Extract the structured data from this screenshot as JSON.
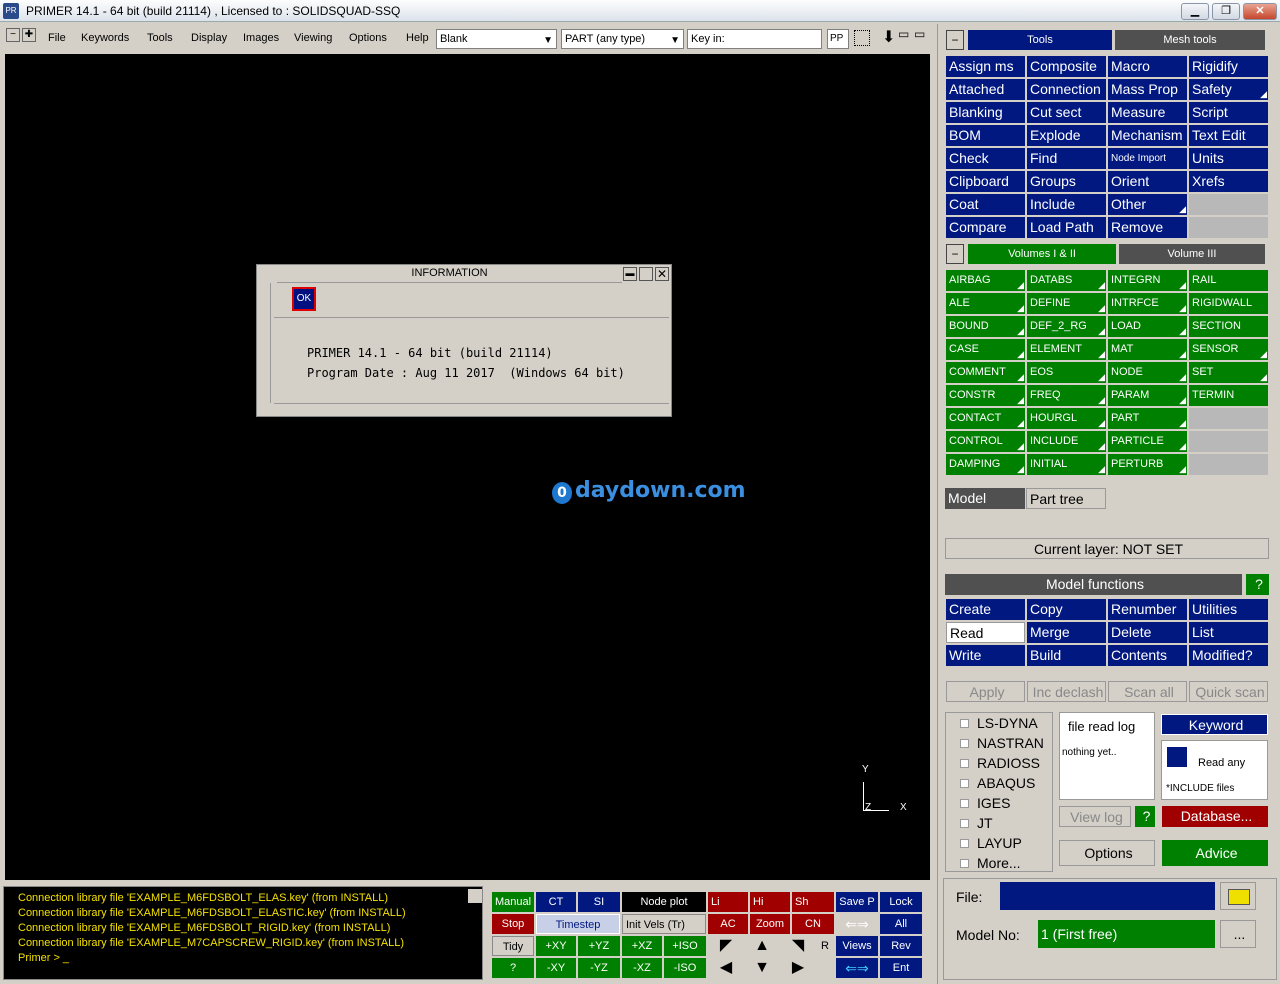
{
  "window": {
    "title": "PRIMER 14.1 - 64 bit (build 21114) , Licensed to : SOLIDSQUAD-SSQ",
    "app_icon": "PR"
  },
  "menu": [
    "File",
    "Keywords",
    "Tools",
    "Display",
    "Images",
    "Viewing",
    "Options",
    "Help"
  ],
  "toolbar": {
    "blank_select": "Blank",
    "part_select": "PART  (any type)",
    "keyin_label": "Key in:",
    "pp_label": "PP"
  },
  "dialog": {
    "title": "INFORMATION",
    "ok": "OK",
    "line1": "PRIMER 14.1 - 64 bit (build 21114)",
    "line2": "Program Date : Aug 11 2017  (Windows 64 bit)"
  },
  "watermark": "daydown.com",
  "axes": {
    "y": "Y",
    "x": "X",
    "z": "Z"
  },
  "console": [
    "Connection library file 'EXAMPLE_M6FDSBOLT_ELAS.key' (from INSTALL)",
    "Connection library file 'EXAMPLE_M6FDSBOLT_ELASTIC.key' (from INSTALL)",
    "Connection library file 'EXAMPLE_M6FDSBOLT_RIGID.key' (from INSTALL)",
    "Connection library file 'EXAMPLE_M7CAPSCREW_RIGID.key' (from INSTALL)",
    "Primer > _"
  ],
  "bottom": {
    "manual": "Manual",
    "ct": "CT",
    "si": "SI",
    "node_plot": "Node plot",
    "li": "Li",
    "hi": "Hi",
    "sh": "Sh",
    "save_p": "Save P",
    "lock": "Lock",
    "stop": "Stop",
    "timestep": "Timestep",
    "init_vels": "Init Vels (Tr)",
    "ac": "AC",
    "zoom": "Zoom",
    "cn": "CN",
    "all": "All",
    "tidy": "Tidy",
    "pxy": "+XY",
    "pyz": "+YZ",
    "pxz": "+XZ",
    "piso": "+ISO",
    "r": "R",
    "views": "Views",
    "rev": "Rev",
    "q": "?",
    "mxy": "-XY",
    "myz": "-YZ",
    "mxz": "-XZ",
    "miso": "-ISO",
    "ent": "Ent"
  },
  "tools": {
    "tab_tools": "Tools",
    "tab_mesh": "Mesh tools",
    "grid": [
      [
        "Assign ms",
        "Composite",
        "Macro",
        "Rigidify"
      ],
      [
        "Attached",
        "Connection",
        "Mass Prop",
        "Safety"
      ],
      [
        "Blanking",
        "Cut sect",
        "Measure",
        "Script"
      ],
      [
        "BOM",
        "Explode",
        "Mechanism",
        "Text Edit"
      ],
      [
        "Check",
        "Find",
        "Node Import",
        "Units"
      ],
      [
        "Clipboard",
        "Groups",
        "Orient",
        "Xrefs"
      ],
      [
        "Coat",
        "Include",
        "Other",
        ""
      ],
      [
        "Compare",
        "Load Path",
        "Remove",
        ""
      ]
    ]
  },
  "keywords": {
    "tab_vol12": "Volumes I & II",
    "tab_vol3": "Volume III",
    "grid": [
      [
        "AIRBAG",
        "DATABS",
        "INTEGRN",
        "RAIL"
      ],
      [
        "ALE",
        "DEFINE",
        "INTRFCE",
        "RIGIDWALL"
      ],
      [
        "BOUND",
        "DEF_2_RG",
        "LOAD",
        "SECTION"
      ],
      [
        "CASE",
        "ELEMENT",
        "MAT",
        "SENSOR"
      ],
      [
        "COMMENT",
        "EOS",
        "NODE",
        "SET"
      ],
      [
        "CONSTR",
        "FREQ",
        "PARAM",
        "TERMIN"
      ],
      [
        "CONTACT",
        "HOURGL",
        "PART",
        ""
      ],
      [
        "CONTROL",
        "INCLUDE",
        "PARTICLE",
        ""
      ],
      [
        "DAMPING",
        "INITIAL",
        "PERTURB",
        ""
      ]
    ]
  },
  "tree": {
    "model": "Model",
    "part_tree": "Part tree",
    "layer": "Current layer: NOT SET"
  },
  "model_functions": {
    "title": "Model functions",
    "help": "?",
    "grid": [
      [
        "Create",
        "Copy",
        "Renumber",
        "Utilities"
      ],
      [
        "Read",
        "Merge",
        "Delete",
        "List"
      ],
      [
        "Write",
        "Build",
        "Contents",
        "Modified?"
      ]
    ],
    "actions": [
      "Apply",
      "Inc declash",
      "Scan all",
      "Quick scan"
    ]
  },
  "formats": [
    "LS-DYNA",
    "NASTRAN",
    "RADIOSS",
    "ABAQUS",
    "IGES",
    "JT",
    "LAYUP",
    "More..."
  ],
  "readlog": {
    "title": "file read log",
    "text": "nothing yet..",
    "view_log": "View log",
    "q": "?",
    "options": "Options"
  },
  "keyword_box": {
    "keyword": "Keyword",
    "read_any": "Read any",
    "include": "*INCLUDE files",
    "database": "Database...",
    "advice": "Advice"
  },
  "file": {
    "label": "File:",
    "model_no_label": "Model No:",
    "model_no": "1 (First free)",
    "dots": "..."
  },
  "colors": {
    "blue": "#001880",
    "green": "#008000",
    "red": "#a00000"
  }
}
